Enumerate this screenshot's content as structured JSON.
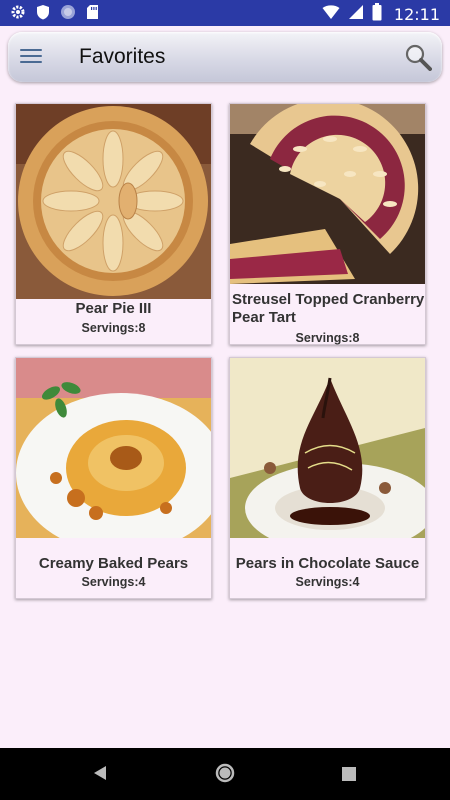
{
  "status_bar": {
    "time": "12:11"
  },
  "app_bar": {
    "title": "Favorites"
  },
  "recipes": [
    {
      "title": "Pear Pie III",
      "servings": "Servings:8"
    },
    {
      "title": "Streusel Topped Cranberry Pear Tart",
      "servings": "Servings:8"
    },
    {
      "title": "Creamy Baked Pears",
      "servings": "Servings:4"
    },
    {
      "title": "Pears in Chocolate Sauce",
      "servings": "Servings:4"
    }
  ],
  "colors": {
    "status_bar": "#2b3aa6",
    "background": "#fbeefa",
    "nav_bar": "#000000"
  }
}
